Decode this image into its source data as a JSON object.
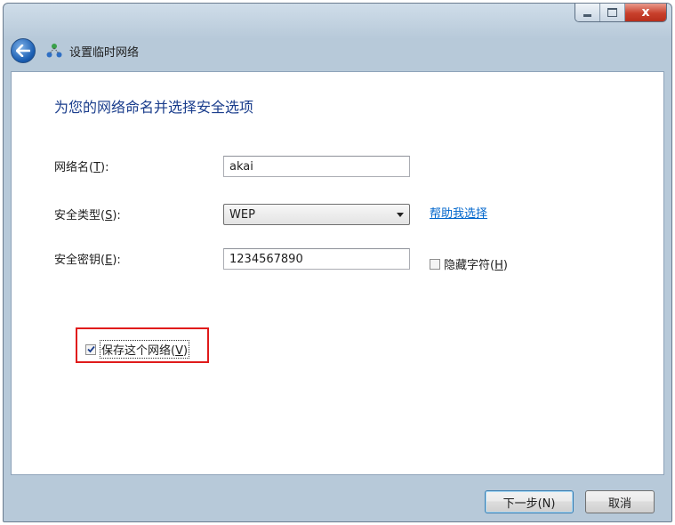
{
  "window": {
    "caption_buttons": {
      "close_glyph": "x"
    }
  },
  "nav": {
    "title": "设置临时网络",
    "back_icon": "back-arrow-icon",
    "network_icon": "network-icon"
  },
  "main": {
    "heading": "为您的网络命名并选择安全选项",
    "network_name": {
      "label": "网络名",
      "accel": "T",
      "value": "akai"
    },
    "security_type": {
      "label": "安全类型",
      "accel": "S",
      "selected": "WEP",
      "help_link": "帮助我选择"
    },
    "security_key": {
      "label": "安全密钥",
      "accel": "E",
      "value": "1234567890",
      "hide_chars": {
        "label": "隐藏字符",
        "accel": "H",
        "checked": false
      }
    },
    "save_network": {
      "label": "保存这个网络",
      "accel": "V",
      "checked": true
    },
    "highlight_color": "#e01b1b"
  },
  "footer": {
    "next_label": "下一步(N)",
    "cancel_label": "取消"
  }
}
